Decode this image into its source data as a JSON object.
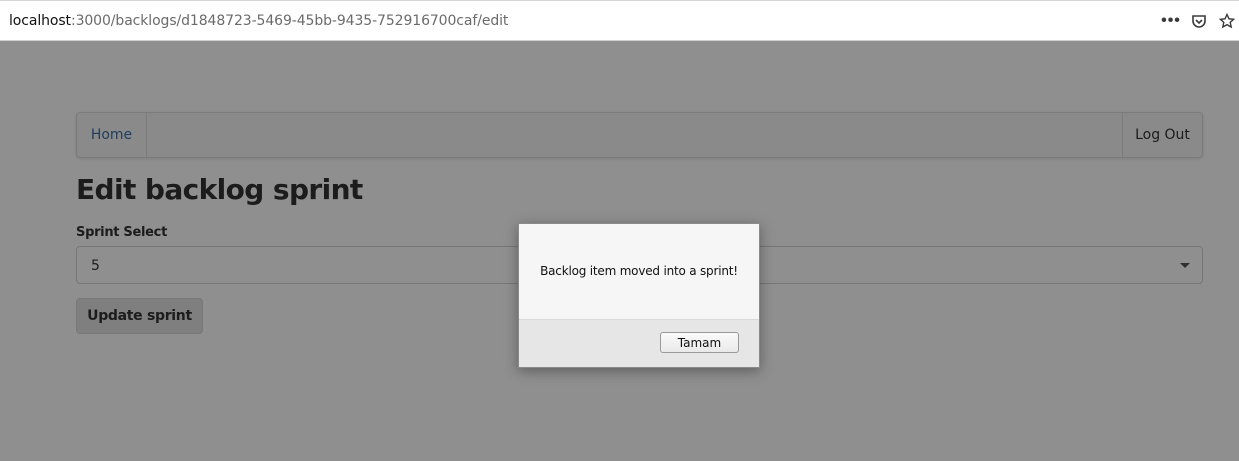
{
  "browser": {
    "url_host": "localhost",
    "url_rest": ":3000/backlogs/d1848723-5469-45bb-9435-752916700caf/edit",
    "icons": [
      "more-dots-icon",
      "pocket-icon",
      "bookmark-star-icon"
    ]
  },
  "navbar": {
    "home_label": "Home",
    "logout_label": "Log Out"
  },
  "page": {
    "title": "Edit backlog sprint",
    "sprint_select_label": "Sprint Select",
    "sprint_select_value": "5",
    "update_button_label": "Update sprint"
  },
  "dialog": {
    "message": "Backlog item moved into a sprint!",
    "ok_label": "Tamam"
  },
  "colors": {
    "link": "#3b6ea8",
    "overlay": "rgba(0,0,0,0.44)"
  }
}
